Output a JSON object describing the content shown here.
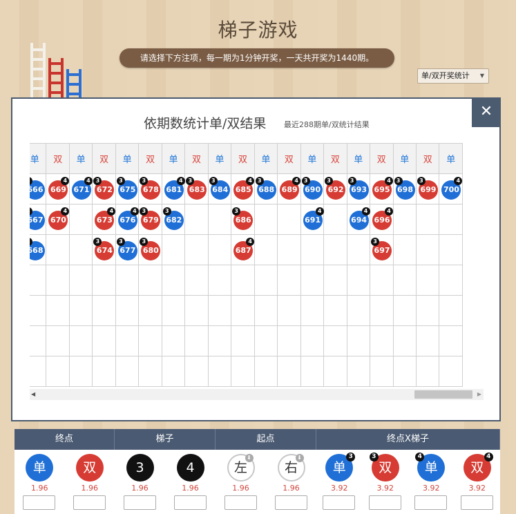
{
  "page": {
    "title": "梯子游戏",
    "notice": "请选择下方注项，每一期为1分钟开奖，一天共开奖为1440期。",
    "stat_select": {
      "value": "单/双开奖统计",
      "arrow": "▼"
    }
  },
  "colors": {
    "odd": "#1f6fd6",
    "even": "#d63c33",
    "header_bar": "#4a5a72"
  },
  "modal": {
    "close_label": "✕",
    "title": "依期数统计单/双结果",
    "subtitle": "最近288期单/双统计结果",
    "scroll_left": "◀",
    "scroll_right": "▶",
    "columns": [
      {
        "label": "单",
        "type": "odd",
        "balls": [
          {
            "n": "666",
            "c": "blue",
            "b": "3"
          },
          {
            "n": "667",
            "c": "blue",
            "b": "3"
          },
          {
            "n": "668",
            "c": "blue",
            "b": "3"
          }
        ]
      },
      {
        "label": "双",
        "type": "even",
        "balls": [
          {
            "n": "669",
            "c": "red",
            "b": "4"
          },
          {
            "n": "670",
            "c": "red",
            "b": "4"
          }
        ]
      },
      {
        "label": "单",
        "type": "odd",
        "balls": [
          {
            "n": "671",
            "c": "blue",
            "b": "4"
          }
        ]
      },
      {
        "label": "双",
        "type": "even",
        "balls": [
          {
            "n": "672",
            "c": "red",
            "b": "3"
          },
          {
            "n": "673",
            "c": "red",
            "b": "4"
          },
          {
            "n": "674",
            "c": "red",
            "b": "3"
          }
        ]
      },
      {
        "label": "单",
        "type": "odd",
        "balls": [
          {
            "n": "675",
            "c": "blue",
            "b": "3"
          },
          {
            "n": "676",
            "c": "blue",
            "b": "4"
          },
          {
            "n": "677",
            "c": "blue",
            "b": "3"
          }
        ]
      },
      {
        "label": "双",
        "type": "even",
        "balls": [
          {
            "n": "678",
            "c": "red",
            "b": "3"
          },
          {
            "n": "679",
            "c": "red",
            "b": "3"
          },
          {
            "n": "680",
            "c": "red",
            "b": "3"
          }
        ]
      },
      {
        "label": "单",
        "type": "odd",
        "balls": [
          {
            "n": "681",
            "c": "blue",
            "b": "4"
          },
          {
            "n": "682",
            "c": "blue",
            "b": "3"
          }
        ]
      },
      {
        "label": "双",
        "type": "even",
        "balls": [
          {
            "n": "683",
            "c": "red",
            "b": "3"
          }
        ]
      },
      {
        "label": "单",
        "type": "odd",
        "balls": [
          {
            "n": "684",
            "c": "blue",
            "b": "3"
          }
        ]
      },
      {
        "label": "双",
        "type": "even",
        "balls": [
          {
            "n": "685",
            "c": "red",
            "b": "4"
          },
          {
            "n": "686",
            "c": "red",
            "b": "3"
          },
          {
            "n": "687",
            "c": "red",
            "b": "4"
          }
        ]
      },
      {
        "label": "单",
        "type": "odd",
        "balls": [
          {
            "n": "688",
            "c": "blue",
            "b": "3"
          }
        ]
      },
      {
        "label": "双",
        "type": "even",
        "balls": [
          {
            "n": "689",
            "c": "red",
            "b": "4"
          }
        ]
      },
      {
        "label": "单",
        "type": "odd",
        "balls": [
          {
            "n": "690",
            "c": "blue",
            "b": "3"
          },
          {
            "n": "691",
            "c": "blue",
            "b": "4"
          }
        ]
      },
      {
        "label": "双",
        "type": "even",
        "balls": [
          {
            "n": "692",
            "c": "red",
            "b": "3"
          }
        ]
      },
      {
        "label": "单",
        "type": "odd",
        "balls": [
          {
            "n": "693",
            "c": "blue",
            "b": "3"
          },
          {
            "n": "694",
            "c": "blue",
            "b": "4"
          }
        ]
      },
      {
        "label": "双",
        "type": "even",
        "balls": [
          {
            "n": "695",
            "c": "red",
            "b": "4"
          },
          {
            "n": "696",
            "c": "red",
            "b": "4"
          },
          {
            "n": "697",
            "c": "red",
            "b": "3"
          }
        ]
      },
      {
        "label": "单",
        "type": "odd",
        "balls": [
          {
            "n": "698",
            "c": "blue",
            "b": "3"
          }
        ]
      },
      {
        "label": "双",
        "type": "even",
        "balls": [
          {
            "n": "699",
            "c": "red",
            "b": "3"
          }
        ]
      },
      {
        "label": "单",
        "type": "odd",
        "balls": [
          {
            "n": "700",
            "c": "blue",
            "b": "4"
          }
        ]
      }
    ]
  },
  "betting": {
    "sections": [
      {
        "title": "终点",
        "options": [
          {
            "label": "单",
            "style": "blue",
            "odds": "1.96"
          },
          {
            "label": "双",
            "style": "red",
            "odds": "1.96"
          }
        ]
      },
      {
        "title": "梯子",
        "options": [
          {
            "label": "3",
            "style": "black",
            "odds": "1.96"
          },
          {
            "label": "4",
            "style": "black",
            "odds": "1.96"
          }
        ]
      },
      {
        "title": "起点",
        "options": [
          {
            "label": "左",
            "style": "white",
            "odds": "1.96",
            "mark": "⬇"
          },
          {
            "label": "右",
            "style": "white",
            "odds": "1.96",
            "mark": "⬇"
          }
        ]
      },
      {
        "title": "终点X梯子",
        "options": [
          {
            "label": "单",
            "style": "blue",
            "odds": "3.92",
            "badge": "3"
          },
          {
            "label": "双",
            "style": "red",
            "odds": "3.92",
            "badge": "3",
            "badge_left": true
          },
          {
            "label": "单",
            "style": "blue",
            "odds": "3.92",
            "badge": "4",
            "badge_left": true
          },
          {
            "label": "双",
            "style": "red",
            "odds": "3.92",
            "badge": "4"
          }
        ]
      }
    ]
  }
}
